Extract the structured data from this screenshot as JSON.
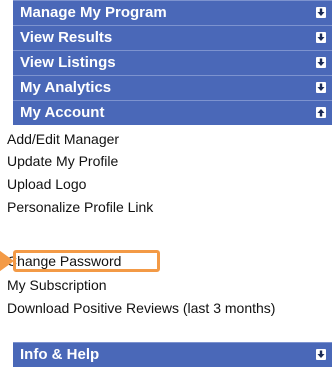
{
  "menu": {
    "sections": [
      {
        "label": "Manage My Program",
        "state": "collapsed"
      },
      {
        "label": "View Results",
        "state": "collapsed"
      },
      {
        "label": "View Listings",
        "state": "collapsed"
      },
      {
        "label": "My Analytics",
        "state": "collapsed"
      },
      {
        "label": "My Account",
        "state": "expanded"
      },
      {
        "label": "Info & Help",
        "state": "collapsed"
      }
    ],
    "account_items": [
      "Add/Edit Manager",
      "Update My Profile",
      "Upload Logo",
      "Personalize Profile Link",
      "Change Password",
      "My Subscription",
      "Download Positive Reviews (last 3 months)"
    ],
    "highlighted_item": "Change Password"
  },
  "colors": {
    "section_bar": "#4a68b8",
    "highlight": "#f39a46"
  }
}
